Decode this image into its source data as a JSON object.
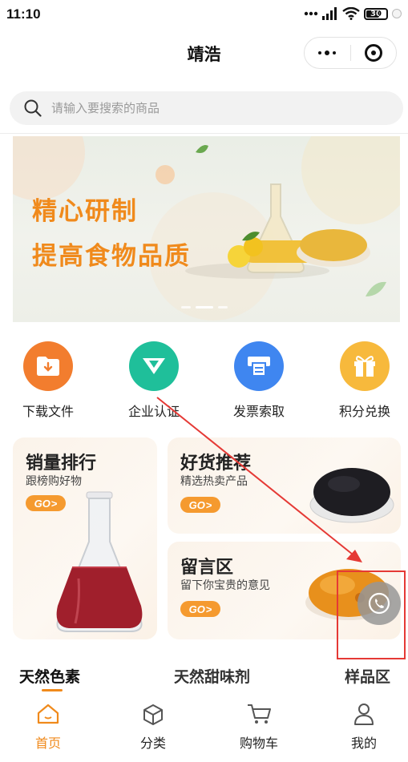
{
  "status_bar": {
    "time": "11:10",
    "battery": "30"
  },
  "nav": {
    "title": "靖浩",
    "more_icon": "more-dots-icon",
    "close_icon": "target-circle-icon"
  },
  "search": {
    "placeholder": "请输入要搜索的商品"
  },
  "banner": {
    "line1": "精心研制",
    "line2": "提高食物品质"
  },
  "quick_links": [
    {
      "label": "下载文件",
      "icon": "folder-download-icon",
      "color": "#f27d2e"
    },
    {
      "label": "企业认证",
      "icon": "v-badge-icon",
      "color": "#1fbf9a"
    },
    {
      "label": "发票索取",
      "icon": "invoice-printer-icon",
      "color": "#3f86f0"
    },
    {
      "label": "积分兑换",
      "icon": "gift-icon",
      "color": "#f7b93c"
    }
  ],
  "promo_cards": {
    "sales": {
      "title": "销量排行",
      "subtitle": "跟榜购好物",
      "go": "GO"
    },
    "recommend": {
      "title": "好货推荐",
      "subtitle": "精选热卖产品",
      "go": "GO"
    },
    "message": {
      "title": "留言区",
      "subtitle": "留下你宝贵的意见",
      "go": "GO"
    }
  },
  "category_tabs": [
    {
      "label": "天然色素",
      "active": true
    },
    {
      "label": "天然甜味剂",
      "active": false
    },
    {
      "label": "样品区",
      "active": false
    }
  ],
  "tabbar": [
    {
      "label": "首页",
      "icon": "home-icon",
      "active": true
    },
    {
      "label": "分类",
      "icon": "category-box-icon",
      "active": false
    },
    {
      "label": "购物车",
      "icon": "cart-icon",
      "active": false
    },
    {
      "label": "我的",
      "icon": "user-icon",
      "active": false
    }
  ],
  "colors": {
    "accent": "#f08a1c",
    "annotation_red": "#e53935"
  }
}
